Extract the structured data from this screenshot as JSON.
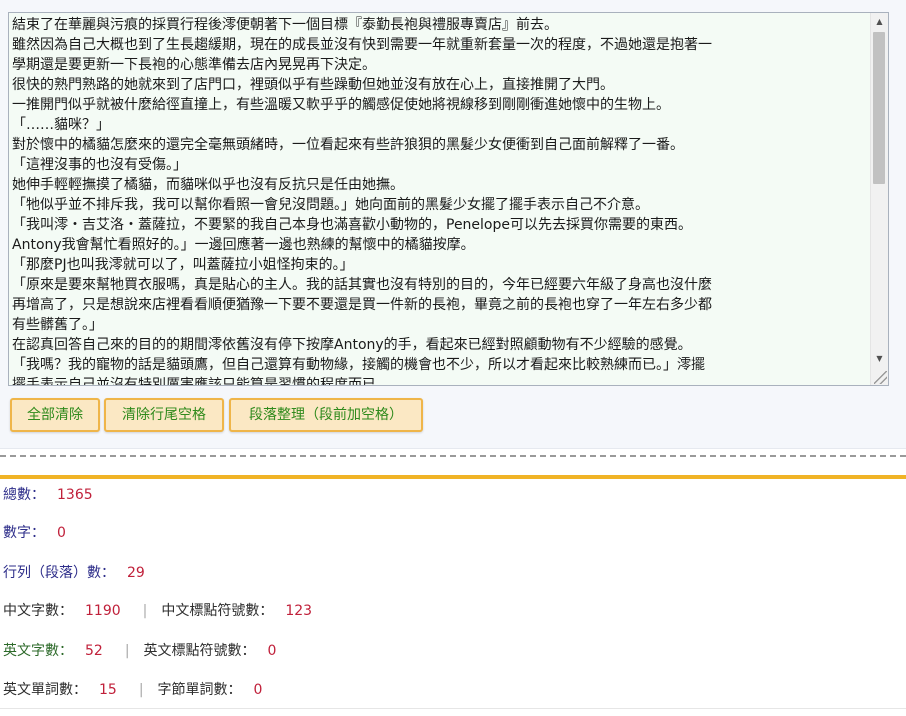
{
  "editor": {
    "lines": [
      "結束了在華麗與污痕的採買行程後澪便朝著下一個目標『泰勤長袍與禮服專賣店』前去。",
      "雖然因為自己大概也到了生長趨緩期，現在的成長並沒有快到需要一年就重新套量一次的程度，不過她還是抱著一",
      "學期還是要更新一下長袍的心態準備去店內晃晃再下決定。",
      "很快的熟門熟路的她就來到了店門口，裡頭似乎有些躁動但她並沒有放在心上，直接推開了大門。",
      "一推開門似乎就被什麼給徑直撞上，有些溫暖又軟乎乎的觸感促使她將視線移到剛剛衝進她懷中的生物上。",
      "「……貓咪？」",
      "對於懷中的橘貓怎麼來的還完全毫無頭緒時，一位看起來有些許狼狽的黑髮少女便衝到自己面前解釋了一番。",
      "「這裡沒事的也沒有受傷。」",
      "她伸手輕輕撫摸了橘貓，而貓咪似乎也沒有反抗只是任由她撫。",
      "「牠似乎並不排斥我，我可以幫你看照一會兒沒問題。」她向面前的黑髮少女擺了擺手表示自己不介意。",
      "「我叫澪・吉艾洛・蓋薩拉，不要緊的我自己本身也滿喜歡小動物的，Penelope可以先去採買你需要的東西。",
      "Antony我會幫忙看照好的。」一邊回應著一邊也熟練的幫懷中的橘貓按摩。",
      "「那麼PJ也叫我澪就可以了，叫蓋薩拉小姐怪拘束的。」",
      "「原來是要來幫牠買衣服嗎，真是貼心的主人。我的話其實也沒有特別的目的，今年已經要六年級了身高也沒什麼",
      "再增高了，只是想說來店裡看看順便猶豫一下要不要還是買一件新的長袍，畢竟之前的長袍也穿了一年左右多少都",
      "有些髒舊了。」",
      "在認真回答自己來的目的的期間澪依舊沒有停下按摩Antony的手，看起來已經對照顧動物有不少經驗的感覺。",
      "「我嗎？我的寵物的話是貓頭鷹，但自己還算有動物緣，接觸的機會也不少，所以才看起來比較熟練而已。」澪擺",
      "擺手表示自己並沒有特別厲害應該只能算是習慣的程度而已。"
    ]
  },
  "buttons": {
    "clear_all": "全部清除",
    "trim_trailing": "清除行尾空格",
    "paragraph_format": "段落整理（段前加空格）"
  },
  "stats": {
    "total_label": "總數：",
    "total_value": "1365",
    "digits_label": "數字：",
    "digits_value": "0",
    "lines_label": "行列（段落）數：",
    "lines_value": "29",
    "zh_chars_label": "中文字數：",
    "zh_chars_value": "1190",
    "zh_punct_label": "中文標點符號數：",
    "zh_punct_value": "123",
    "en_chars_label": "英文字數：",
    "en_chars_value": "52",
    "en_punct_label": "英文標點符號數：",
    "en_punct_value": "0",
    "en_words_label": "英文單詞數：",
    "en_words_value": "15",
    "byte_words_label": "字節單詞數：",
    "byte_words_value": "0",
    "separator": "|"
  },
  "colors": {
    "button_bg": "#fbe8c4",
    "button_border": "#efb549",
    "button_text": "#2f8a1c",
    "value_text": "#c0203a",
    "divider_gold": "#f0b326",
    "textarea_bg": "#f4fbf5"
  },
  "icons": {
    "scroll_up": "triangle-up-icon",
    "scroll_down": "triangle-down-icon",
    "resize": "resize-grip-icon"
  }
}
